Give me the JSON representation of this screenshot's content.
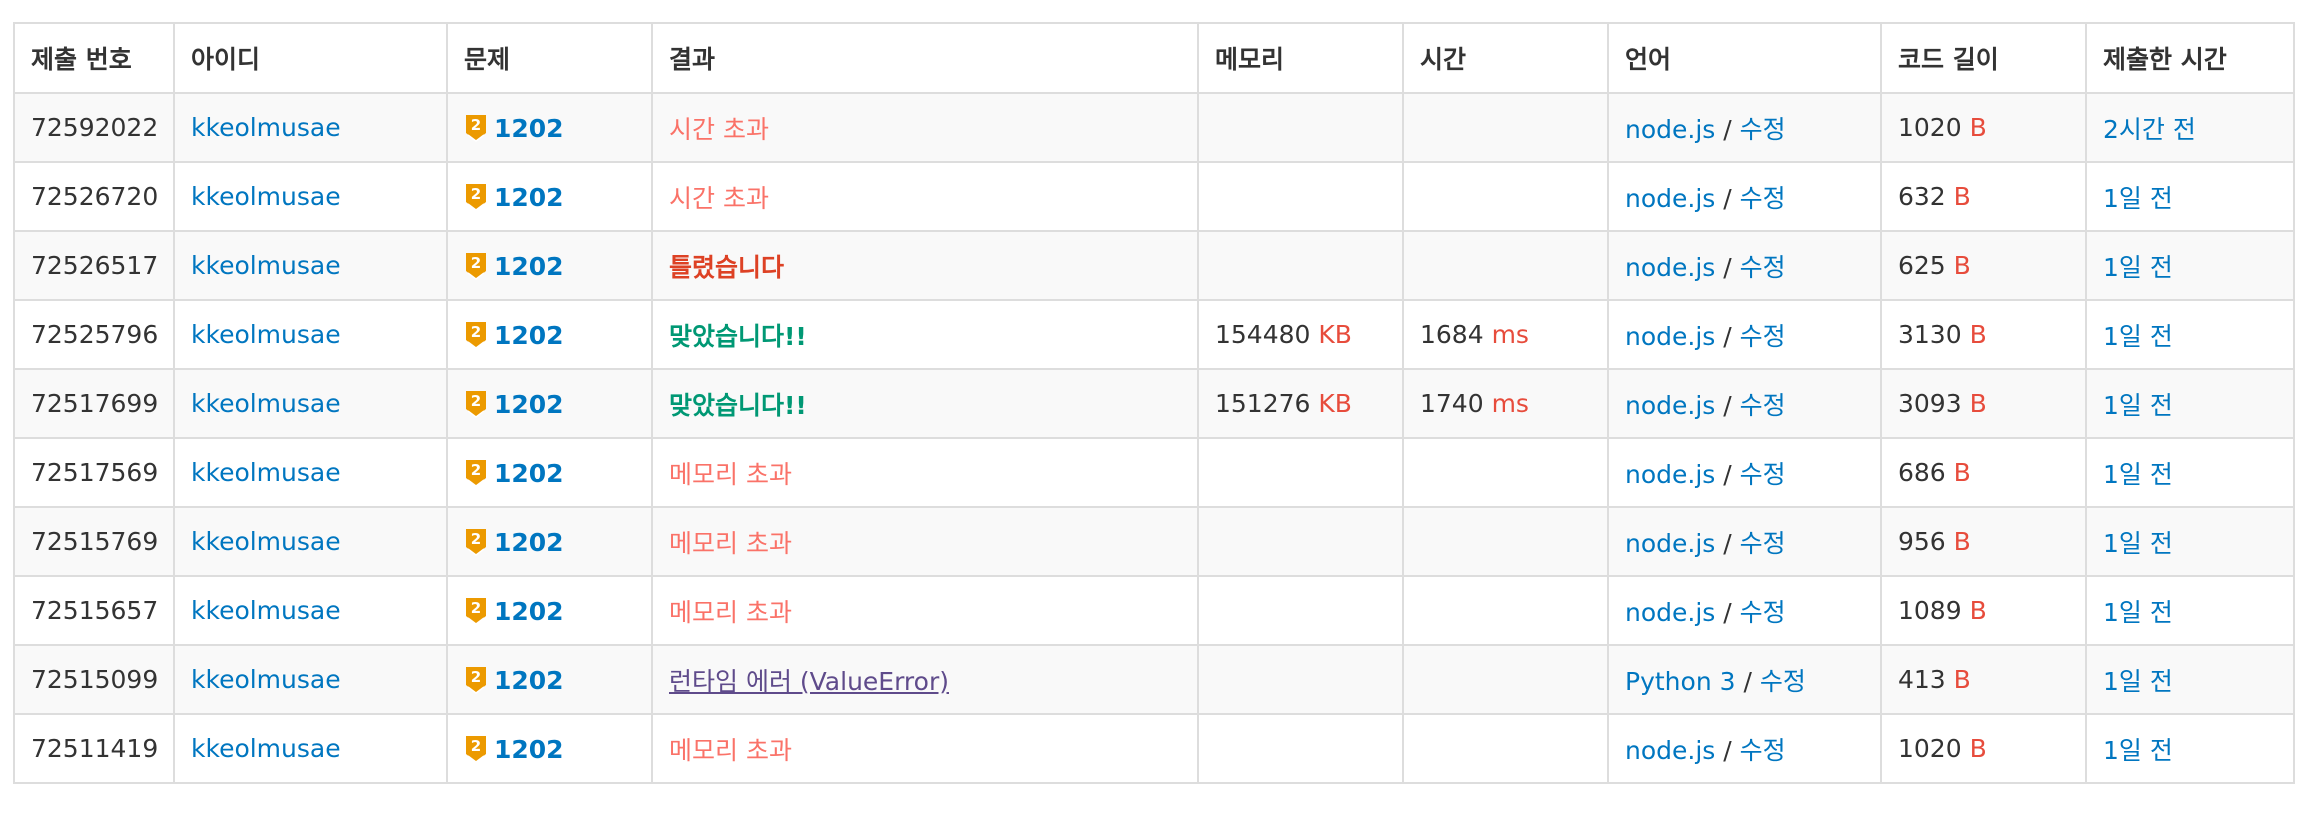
{
  "colors": {
    "link": "#0076c0",
    "accepted": "#009874",
    "time_limit": "#fa7268",
    "wrong": "#dd4124",
    "memory_limit": "#fa7268",
    "runtime_error": "#5f4b8b",
    "unit": "#e74c3c",
    "tier_gold": "#ec9a00"
  },
  "table": {
    "headers": {
      "submission_id": "제출 번호",
      "user_id": "아이디",
      "problem": "문제",
      "result": "결과",
      "memory": "메모리",
      "time": "시간",
      "language": "언어",
      "code_length": "코드 길이",
      "submitted_at": "제출한 시간"
    },
    "rows": [
      {
        "submission_id": "72592022",
        "user": "kkeolmusae",
        "tier_icon": "gold-2-tier-icon",
        "tier_level": "2",
        "problem": "1202",
        "result": "시간 초과",
        "result_type": "tle",
        "memory": "",
        "memory_unit": "",
        "time": "",
        "time_unit": "",
        "language": "node.js",
        "lang_sep": "/",
        "edit": "수정",
        "code_length": "1020",
        "code_unit": "B",
        "submitted": "2시간 전"
      },
      {
        "submission_id": "72526720",
        "user": "kkeolmusae",
        "tier_icon": "gold-2-tier-icon",
        "tier_level": "2",
        "problem": "1202",
        "result": "시간 초과",
        "result_type": "tle",
        "memory": "",
        "memory_unit": "",
        "time": "",
        "time_unit": "",
        "language": "node.js",
        "lang_sep": "/",
        "edit": "수정",
        "code_length": "632",
        "code_unit": "B",
        "submitted": "1일 전"
      },
      {
        "submission_id": "72526517",
        "user": "kkeolmusae",
        "tier_icon": "gold-2-tier-icon",
        "tier_level": "2",
        "problem": "1202",
        "result": "틀렸습니다",
        "result_type": "wrong",
        "memory": "",
        "memory_unit": "",
        "time": "",
        "time_unit": "",
        "language": "node.js",
        "lang_sep": "/",
        "edit": "수정",
        "code_length": "625",
        "code_unit": "B",
        "submitted": "1일 전"
      },
      {
        "submission_id": "72525796",
        "user": "kkeolmusae",
        "tier_icon": "gold-2-tier-icon",
        "tier_level": "2",
        "problem": "1202",
        "result": "맞았습니다!!",
        "result_type": "ac",
        "memory": "154480",
        "memory_unit": "KB",
        "time": "1684",
        "time_unit": "ms",
        "language": "node.js",
        "lang_sep": "/",
        "edit": "수정",
        "code_length": "3130",
        "code_unit": "B",
        "submitted": "1일 전"
      },
      {
        "submission_id": "72517699",
        "user": "kkeolmusae",
        "tier_icon": "gold-2-tier-icon",
        "tier_level": "2",
        "problem": "1202",
        "result": "맞았습니다!!",
        "result_type": "ac",
        "memory": "151276",
        "memory_unit": "KB",
        "time": "1740",
        "time_unit": "ms",
        "language": "node.js",
        "lang_sep": "/",
        "edit": "수정",
        "code_length": "3093",
        "code_unit": "B",
        "submitted": "1일 전"
      },
      {
        "submission_id": "72517569",
        "user": "kkeolmusae",
        "tier_icon": "gold-2-tier-icon",
        "tier_level": "2",
        "problem": "1202",
        "result": "메모리 초과",
        "result_type": "mle",
        "memory": "",
        "memory_unit": "",
        "time": "",
        "time_unit": "",
        "language": "node.js",
        "lang_sep": "/",
        "edit": "수정",
        "code_length": "686",
        "code_unit": "B",
        "submitted": "1일 전"
      },
      {
        "submission_id": "72515769",
        "user": "kkeolmusae",
        "tier_icon": "gold-2-tier-icon",
        "tier_level": "2",
        "problem": "1202",
        "result": "메모리 초과",
        "result_type": "mle",
        "memory": "",
        "memory_unit": "",
        "time": "",
        "time_unit": "",
        "language": "node.js",
        "lang_sep": "/",
        "edit": "수정",
        "code_length": "956",
        "code_unit": "B",
        "submitted": "1일 전"
      },
      {
        "submission_id": "72515657",
        "user": "kkeolmusae",
        "tier_icon": "gold-2-tier-icon",
        "tier_level": "2",
        "problem": "1202",
        "result": "메모리 초과",
        "result_type": "mle",
        "memory": "",
        "memory_unit": "",
        "time": "",
        "time_unit": "",
        "language": "node.js",
        "lang_sep": "/",
        "edit": "수정",
        "code_length": "1089",
        "code_unit": "B",
        "submitted": "1일 전"
      },
      {
        "submission_id": "72515099",
        "user": "kkeolmusae",
        "tier_icon": "gold-2-tier-icon",
        "tier_level": "2",
        "problem": "1202",
        "result": "런타임 에러 (ValueError)",
        "result_type": "rte",
        "memory": "",
        "memory_unit": "",
        "time": "",
        "time_unit": "",
        "language": "Python 3",
        "lang_sep": "/",
        "edit": "수정",
        "code_length": "413",
        "code_unit": "B",
        "submitted": "1일 전"
      },
      {
        "submission_id": "72511419",
        "user": "kkeolmusae",
        "tier_icon": "gold-2-tier-icon",
        "tier_level": "2",
        "problem": "1202",
        "result": "메모리 초과",
        "result_type": "mle",
        "memory": "",
        "memory_unit": "",
        "time": "",
        "time_unit": "",
        "language": "node.js",
        "lang_sep": "/",
        "edit": "수정",
        "code_length": "1020",
        "code_unit": "B",
        "submitted": "1일 전"
      }
    ]
  }
}
